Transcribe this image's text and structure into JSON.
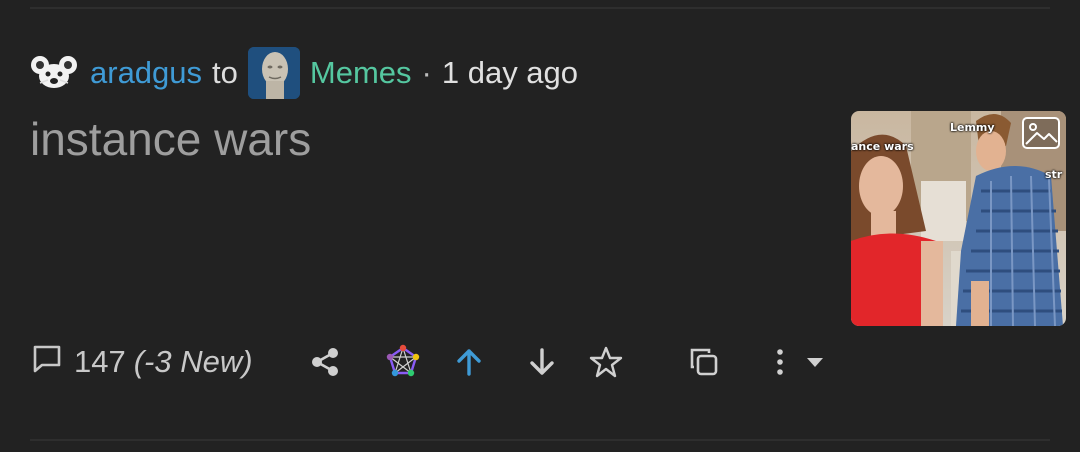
{
  "post": {
    "author": "aradgus",
    "to_label": "to",
    "community": "Memes",
    "separator": "·",
    "time_ago": "1 day ago",
    "title": "instance wars",
    "thumbnail_labels": [
      "Lemmy",
      "ance wars",
      "str"
    ],
    "comments": {
      "count": "147",
      "new": "(-3 New)"
    }
  },
  "icons": {
    "author_avatar": "mouse-icon",
    "community_avatar": "meme-man-icon",
    "thumbnail_badge": "image-icon",
    "comment": "comment-icon",
    "share": "share-icon",
    "fediverse": "fediverse-icon",
    "upvote": "upvote-icon",
    "downvote": "downvote-icon",
    "save": "star-icon",
    "copy": "copy-icon",
    "more": "more-vertical-icon",
    "dropdown": "caret-down-icon"
  },
  "colors": {
    "background": "#222222",
    "author": "#3f9bd6",
    "community": "#55c7a0",
    "title": "#9e9e9e",
    "upvote_active": "#3f9bd6"
  }
}
